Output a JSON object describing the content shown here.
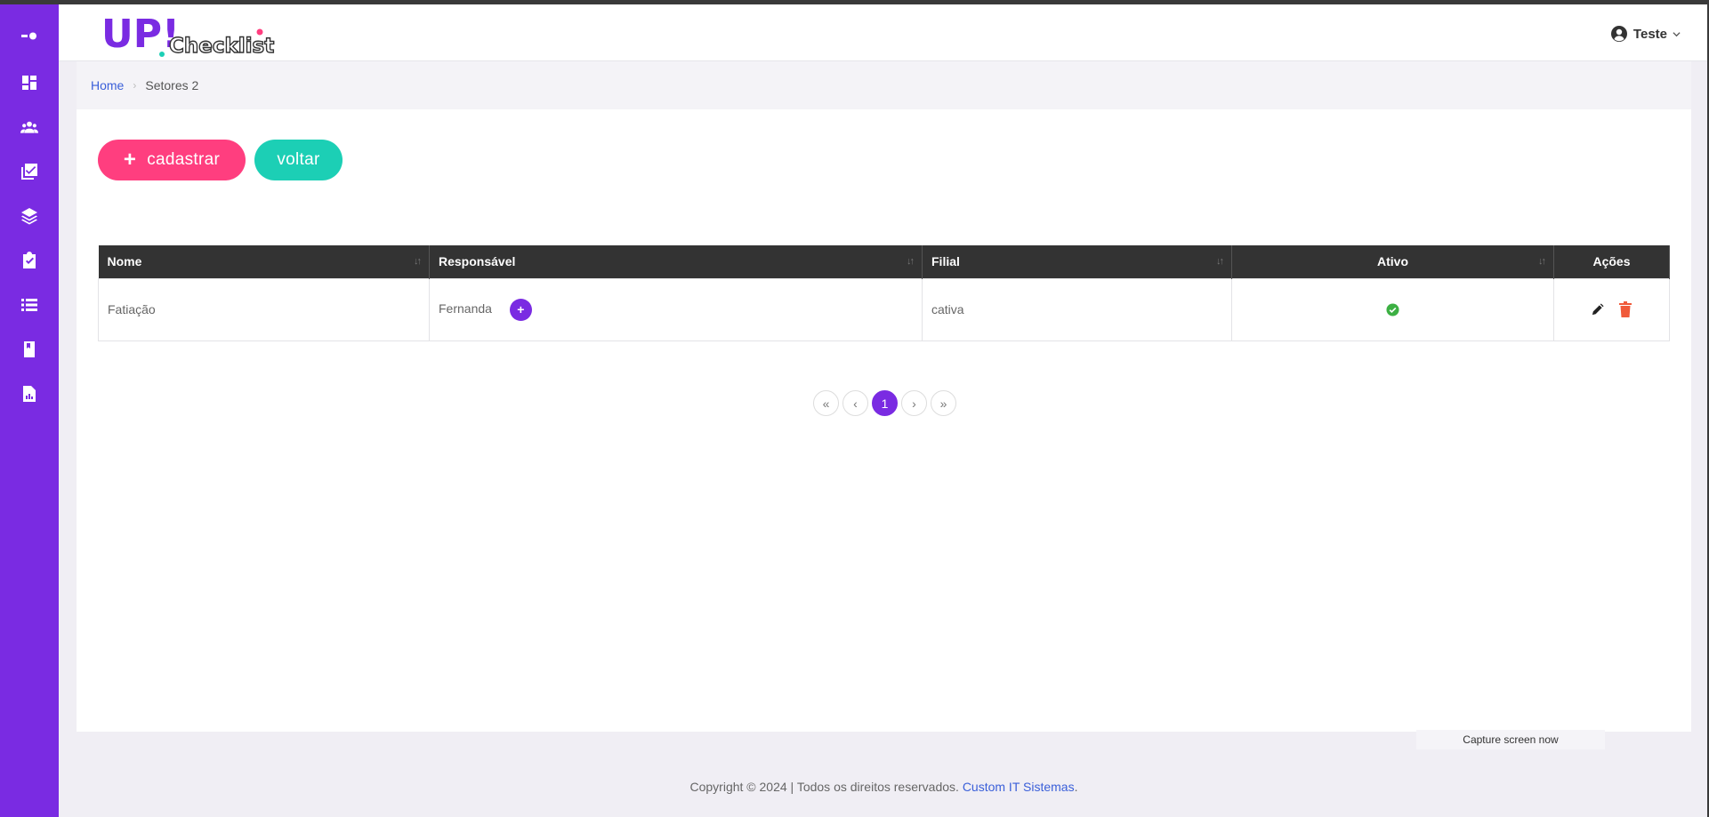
{
  "header": {
    "logo_text": "UP!",
    "logo_sub": "Checklist",
    "user_name": "Teste"
  },
  "sidebar": {
    "items": [
      {
        "icon": "toggle-icon"
      },
      {
        "icon": "dashboard-icon"
      },
      {
        "icon": "users-icon"
      },
      {
        "icon": "checklist-icon"
      },
      {
        "icon": "layers-icon"
      },
      {
        "icon": "clipboard-check-icon"
      },
      {
        "icon": "list-icon"
      },
      {
        "icon": "book-icon"
      },
      {
        "icon": "report-icon"
      }
    ]
  },
  "breadcrumb": {
    "home": "Home",
    "current": "Setores 2"
  },
  "toolbar": {
    "cadastrar_label": "cadastrar",
    "voltar_label": "voltar"
  },
  "table": {
    "columns": [
      "Nome",
      "Responsável",
      "Filial",
      "Ativo",
      "Ações"
    ],
    "rows": [
      {
        "nome": "Fatiação",
        "responsavel": "Fernanda",
        "filial": "cativa",
        "ativo": true
      }
    ]
  },
  "pagination": {
    "first": "«",
    "prev": "‹",
    "current": "1",
    "next": "›",
    "last": "»"
  },
  "capture": {
    "label": "Capture screen now"
  },
  "footer": {
    "text": "Copyright © 2024 | Todos os direitos reservados. ",
    "link": "Custom IT Sistemas",
    "end": "."
  },
  "colors": {
    "sidebar": "#7a2be2",
    "cadastrar": "#ff3e7f",
    "voltar": "#1ccfb5",
    "active_ok": "#3cb043",
    "delete": "#f05a3a"
  }
}
